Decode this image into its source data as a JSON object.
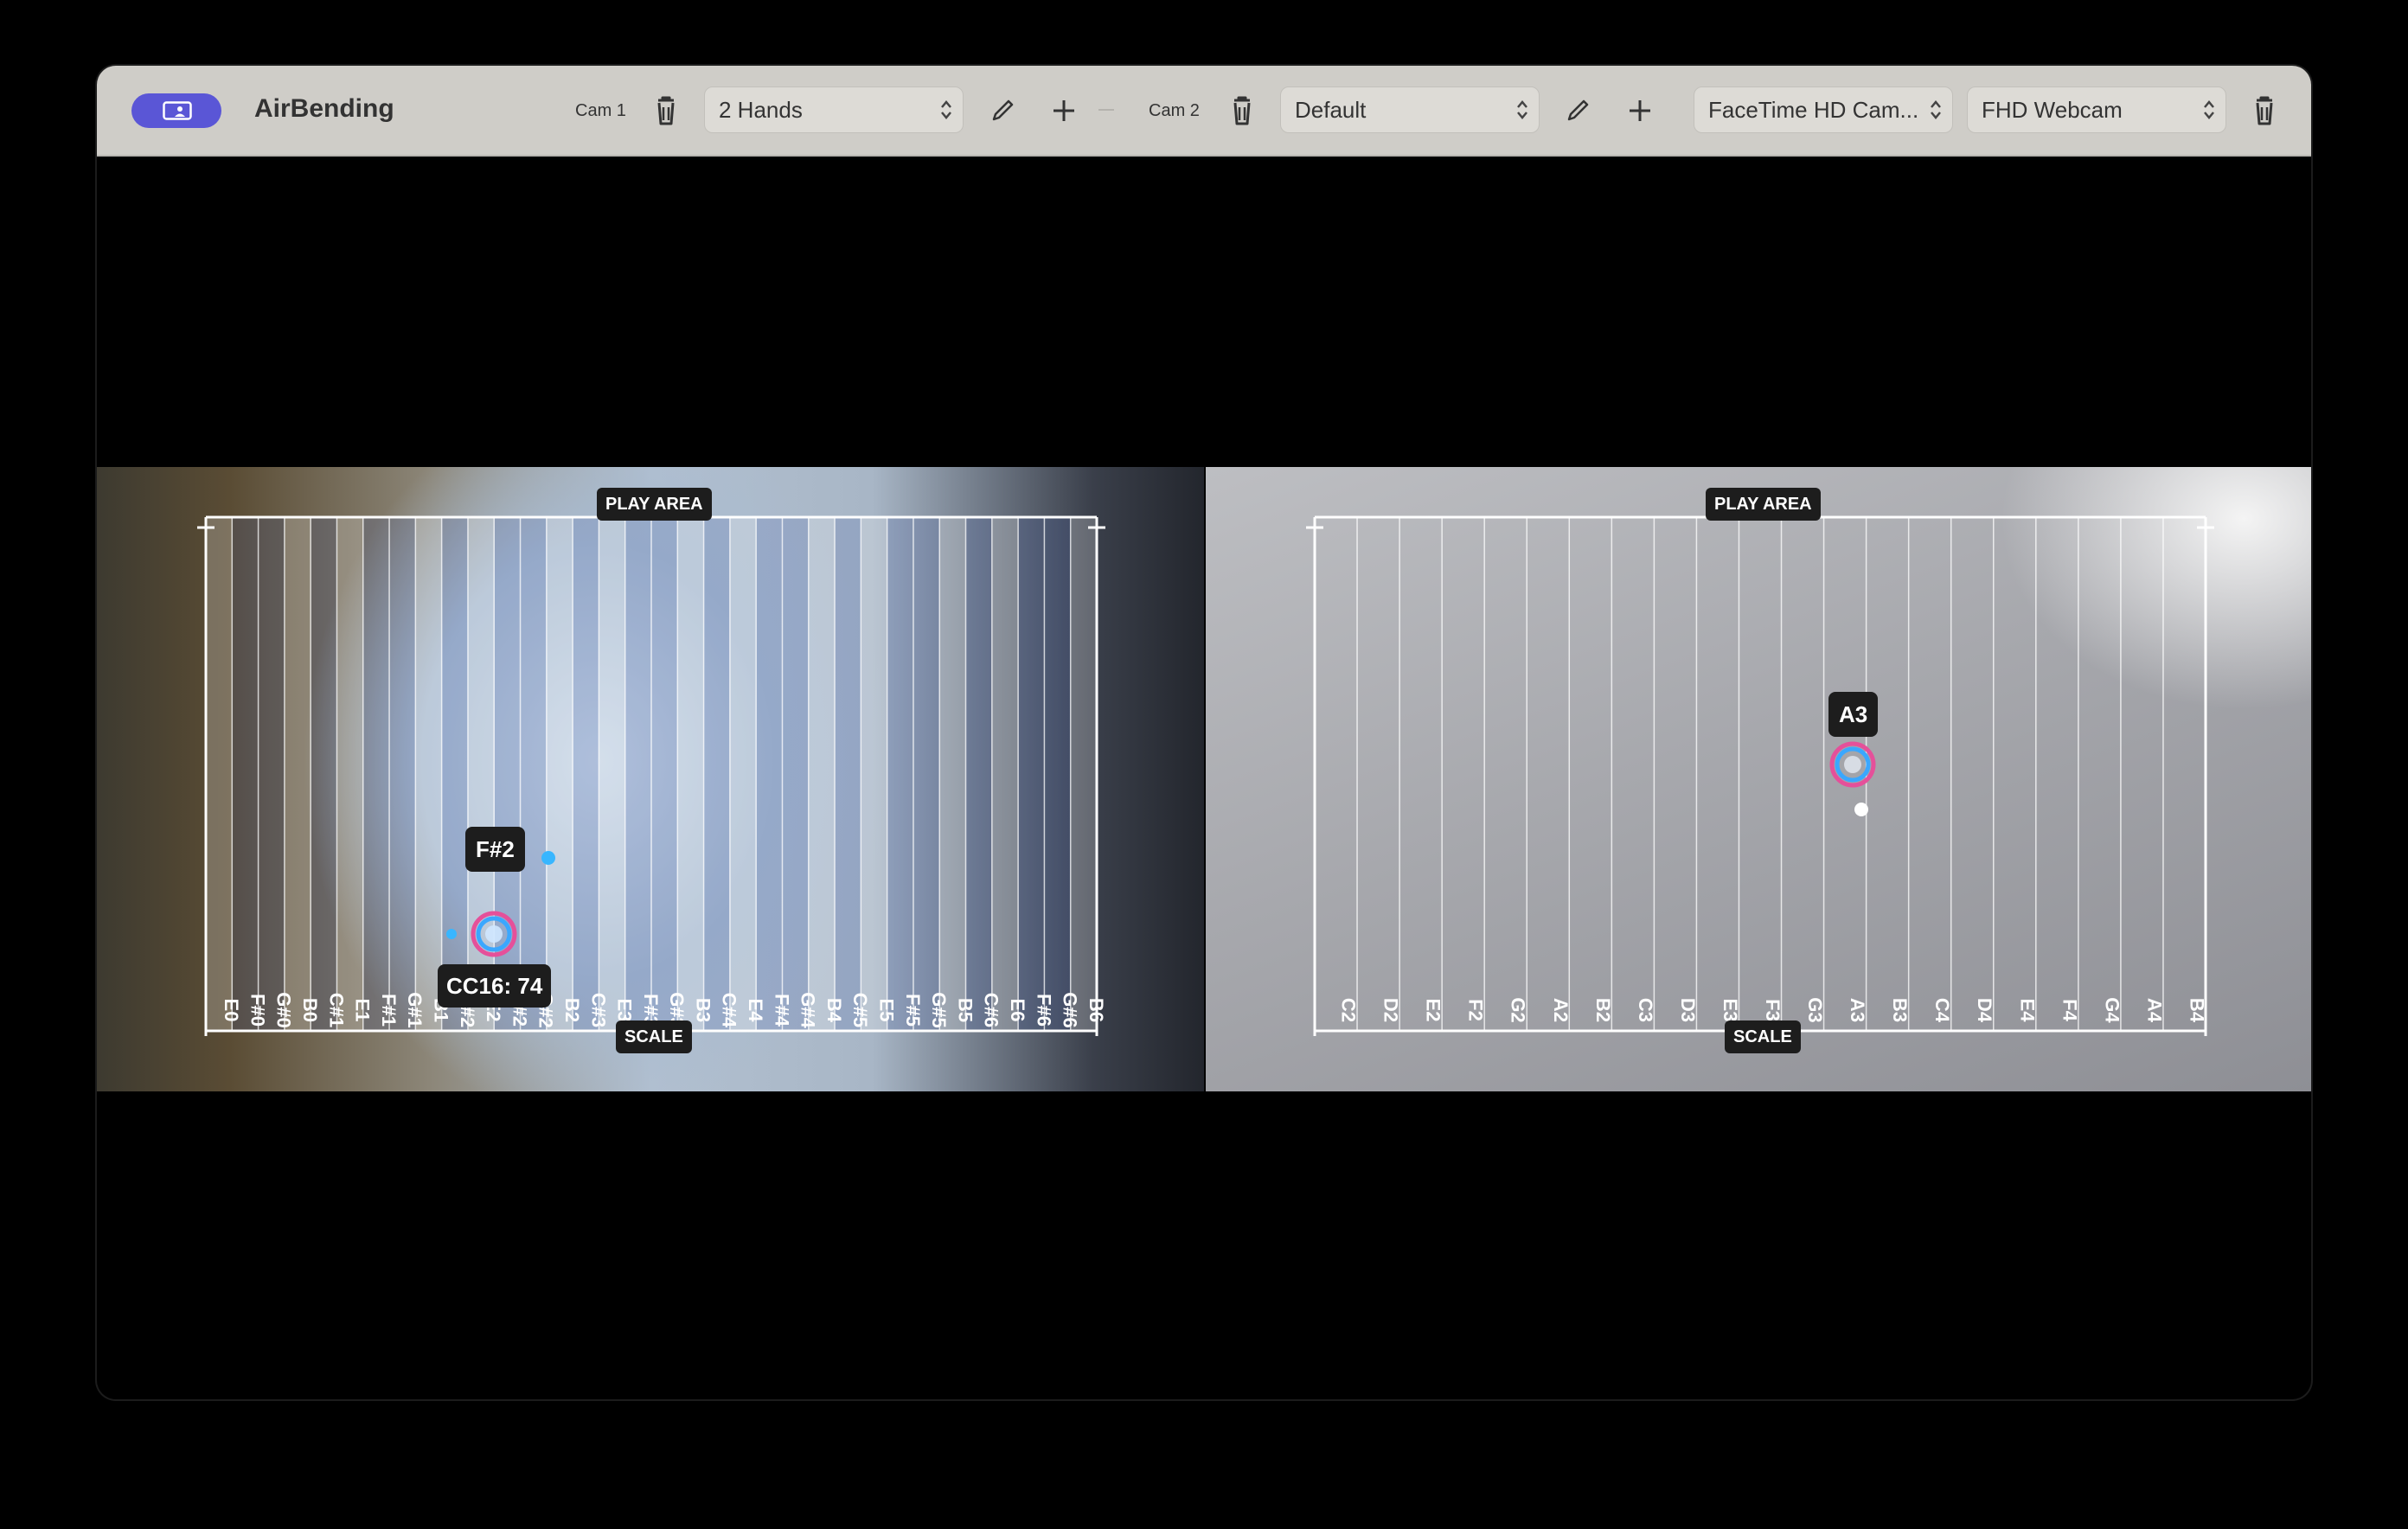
{
  "app": {
    "name": "AirBending"
  },
  "toolbar": {
    "cam1_label": "Cam 1",
    "cam1_preset": "2 Hands",
    "cam2_label": "Cam 2",
    "cam2_preset": "Default",
    "camera_device": "FaceTime HD Cam...",
    "webcam_device": "FHD Webcam"
  },
  "cam1": {
    "play_area_label": "PLAY AREA",
    "scale_label": "SCALE",
    "active_note": "F#2",
    "cc_readout": "CC16: 74",
    "notes": [
      "E0",
      "F#0",
      "G#0",
      "B0",
      "C#1",
      "E1",
      "F#1",
      "G#1",
      "B1",
      "C#2",
      "E2",
      "F#2",
      "G#2",
      "B2",
      "C#3",
      "E3",
      "F#3",
      "G#3",
      "B3",
      "C#4",
      "E4",
      "F#4",
      "G#4",
      "B4",
      "C#5",
      "E5",
      "F#5",
      "G#5",
      "B5",
      "C#6",
      "E6",
      "F#6",
      "G#6",
      "B6"
    ]
  },
  "cam2": {
    "play_area_label": "PLAY AREA",
    "scale_label": "SCALE",
    "active_note": "A3",
    "notes": [
      "C2",
      "D2",
      "E2",
      "F2",
      "G2",
      "A2",
      "B2",
      "C3",
      "D3",
      "E3",
      "F3",
      "G3",
      "A3",
      "B3",
      "C4",
      "D4",
      "E4",
      "F4",
      "G4",
      "A4",
      "B4"
    ]
  },
  "colors": {
    "accent": "#5a56d6",
    "toolbar_bg": "#cfcdc8",
    "pill_bg": "#1d1d1d",
    "pointer_blue": "#3aa7ff",
    "pointer_pink": "#e5509a"
  },
  "icons": {
    "app_icon": "screen-person-icon",
    "delete": "trash-icon",
    "edit": "pencil-icon",
    "add": "plus-icon",
    "select": "chevron-updown-icon"
  }
}
